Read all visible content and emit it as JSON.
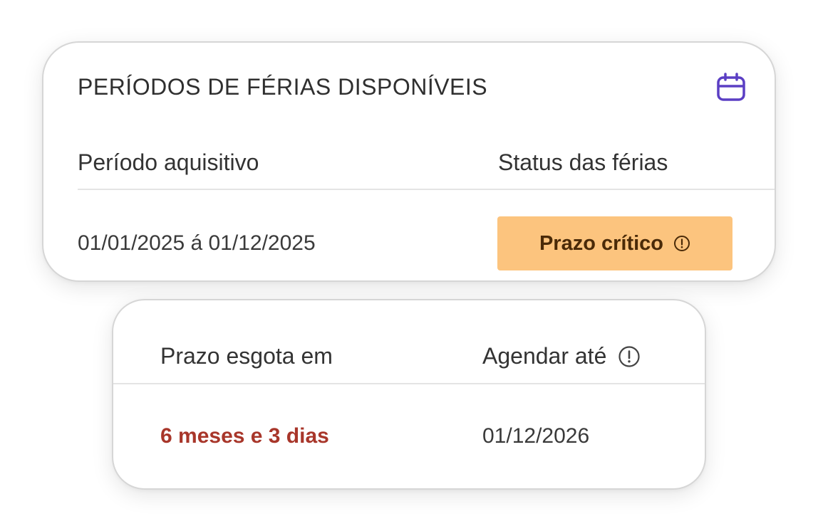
{
  "vacation_card": {
    "title": "PERÍODOS DE FÉRIAS DISPONÍVEIS",
    "icon": "calendar-icon",
    "columns": {
      "period": "Período aquisitivo",
      "status": "Status das férias"
    },
    "row": {
      "period": "01/01/2025 á 01/12/2025",
      "status_label": "Prazo crítico",
      "status_icon": "warning-circle-icon"
    }
  },
  "deadline_card": {
    "columns": {
      "expires": "Prazo esgota em",
      "schedule_until": "Agendar até",
      "schedule_info_icon": "info-circle-icon"
    },
    "row": {
      "expires": "6 meses e 3 dias",
      "schedule_until": "01/12/2026"
    }
  },
  "colors": {
    "accent_purple": "#5b3fc4",
    "status_critical_bg": "#fcc47e",
    "status_critical_text": "#4a2a08",
    "danger_text": "#a8362a"
  }
}
